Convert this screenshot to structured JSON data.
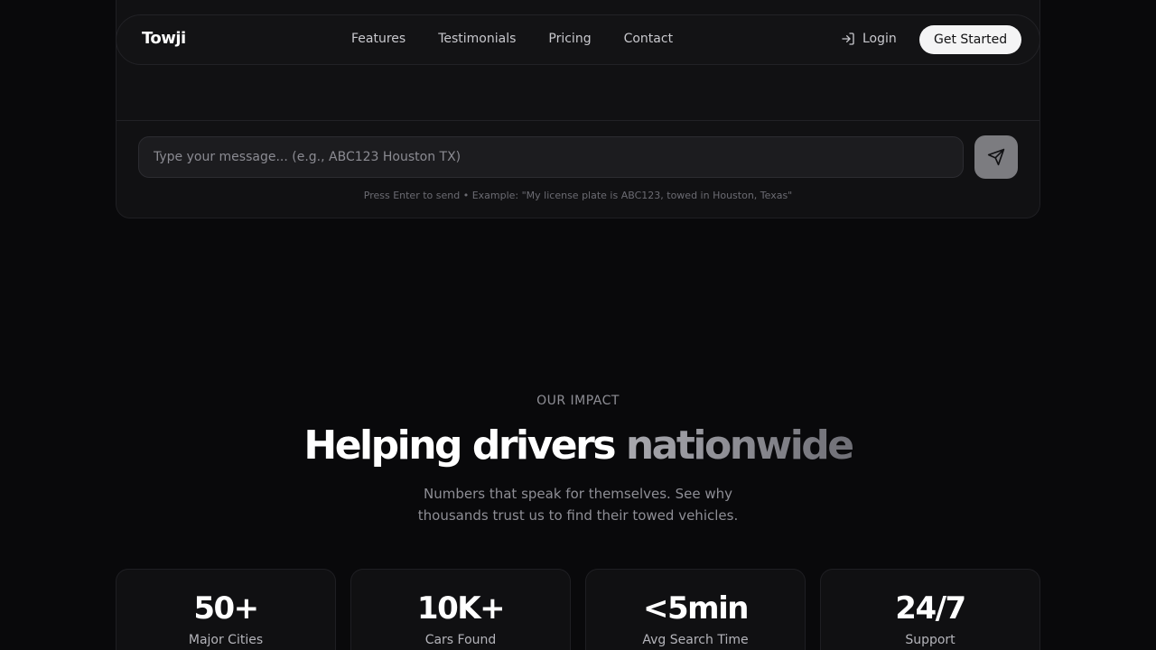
{
  "nav": {
    "logo": "Towji",
    "links": [
      "Features",
      "Testimonials",
      "Pricing",
      "Contact"
    ],
    "login_label": "Login",
    "cta_label": "Get Started"
  },
  "chat": {
    "placeholder": "Type your message... (e.g., ABC123 Houston TX)",
    "hint": "Press Enter to send • Example: \"My license plate is ABC123, towed in Houston, Texas\""
  },
  "impact": {
    "eyebrow": "OUR IMPACT",
    "headline_main": "Helping drivers ",
    "headline_accent": "nationwide",
    "subtitle": "Numbers that speak for themselves. See why thousands trust us to find their towed vehicles."
  },
  "stats": [
    {
      "value": "50+",
      "label": "Major Cities"
    },
    {
      "value": "10K+",
      "label": "Cars Found"
    },
    {
      "value": "<5min",
      "label": "Avg Search Time"
    },
    {
      "value": "24/7",
      "label": "Support"
    }
  ],
  "colors": {
    "background": "#09090b",
    "card": "#111113",
    "cta_bg": "#f4f4f5",
    "send_button": "#7c7c80"
  }
}
